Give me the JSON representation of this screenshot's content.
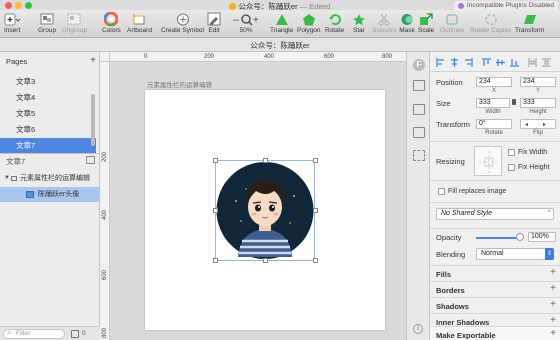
{
  "window": {
    "title": "公众号：陈踊跃er",
    "edited": "— Edited",
    "plugins_badge": "Incompatible Plugins Disabled"
  },
  "toolbar": {
    "insert": "Insert",
    "group": "Group",
    "ungroup": "Ungroup",
    "colors": "Colors",
    "artboard": "Artboard",
    "create_symbol": "Create Symbol",
    "edit": "Edit",
    "zoom": "50%",
    "triangle": "Triangle",
    "polygon": "Polygon",
    "rotate": "Rotate",
    "star": "Star",
    "scissors": "Scissors",
    "mask": "Mask",
    "scale": "Scale",
    "outlines": "Outlines",
    "rotate_copies": "Rotate Copies",
    "transform": "Transform"
  },
  "document": {
    "title": "公众号：陈踊跃er"
  },
  "sidebar": {
    "pages_label": "Pages",
    "pages": [
      {
        "label": "文章3",
        "selected": false
      },
      {
        "label": "文章4",
        "selected": false
      },
      {
        "label": "文章5",
        "selected": false
      },
      {
        "label": "文章6",
        "selected": false
      },
      {
        "label": "文章7",
        "selected": true
      }
    ],
    "layers_header": "文章7",
    "layers": [
      {
        "label": "元素属性栏的运算编辑",
        "selected": false
      },
      {
        "label": "陈踊跃er头像",
        "selected": true
      }
    ],
    "filter_placeholder": "Filter",
    "layer_count": "0"
  },
  "canvas": {
    "ruler_h": [
      "0",
      "200",
      "400",
      "600",
      "800"
    ],
    "ruler_v": [
      "200",
      "400",
      "600",
      "800"
    ],
    "artboard_label": "元素属性栏的运算编辑"
  },
  "inspector": {
    "position_label": "Position",
    "x_value": "234",
    "y_value": "234",
    "x_label": "X",
    "y_label": "Y",
    "size_label": "Size",
    "width_value": "333",
    "height_value": "333",
    "width_label": "Width",
    "height_label": "Height",
    "transform_label": "Transform",
    "rotate_value": "0°",
    "rotate_label": "Rotate",
    "flip_label": "Flip",
    "resizing_label": "Resizing",
    "fix_width": "Fix Width",
    "fix_height": "Fix Height",
    "fill_replaces": "Fill replaces image",
    "shared_style": "No Shared Style",
    "opacity_label": "Opacity",
    "opacity_value": "100%",
    "opacity_fraction": 1.0,
    "blending_label": "Blending",
    "blending_value": "Normal",
    "sections": [
      "Fills",
      "Borders",
      "Shadows",
      "Inner Shadows"
    ],
    "make_exportable": "Make Exportable"
  },
  "colors": {
    "accent": "#4f86e0",
    "avatar_bg": "#12263a",
    "plugins_dot": "#b06ad8"
  }
}
